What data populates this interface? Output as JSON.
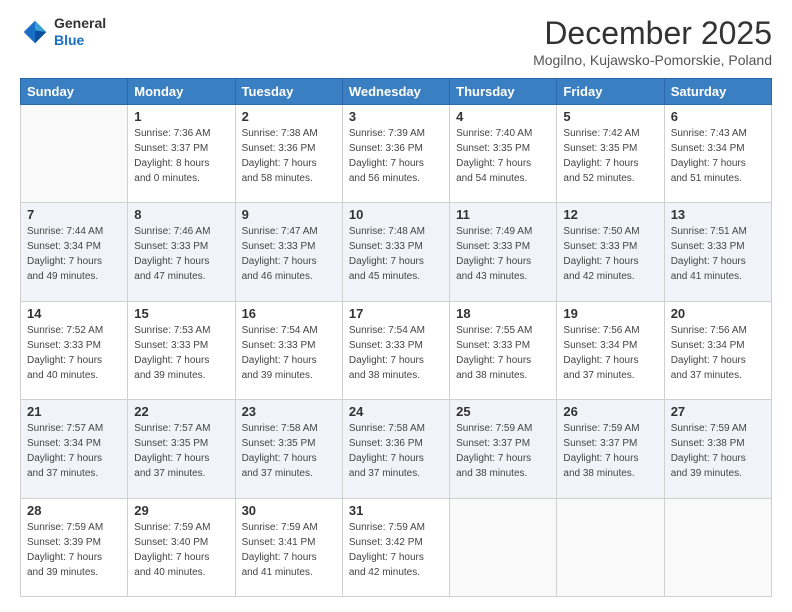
{
  "logo": {
    "general": "General",
    "blue": "Blue"
  },
  "header": {
    "month": "December 2025",
    "location": "Mogilno, Kujawsko-Pomorskie, Poland"
  },
  "weekdays": [
    "Sunday",
    "Monday",
    "Tuesday",
    "Wednesday",
    "Thursday",
    "Friday",
    "Saturday"
  ],
  "weeks": [
    [
      {
        "day": "",
        "info": ""
      },
      {
        "day": "1",
        "info": "Sunrise: 7:36 AM\nSunset: 3:37 PM\nDaylight: 8 hours\nand 0 minutes."
      },
      {
        "day": "2",
        "info": "Sunrise: 7:38 AM\nSunset: 3:36 PM\nDaylight: 7 hours\nand 58 minutes."
      },
      {
        "day": "3",
        "info": "Sunrise: 7:39 AM\nSunset: 3:36 PM\nDaylight: 7 hours\nand 56 minutes."
      },
      {
        "day": "4",
        "info": "Sunrise: 7:40 AM\nSunset: 3:35 PM\nDaylight: 7 hours\nand 54 minutes."
      },
      {
        "day": "5",
        "info": "Sunrise: 7:42 AM\nSunset: 3:35 PM\nDaylight: 7 hours\nand 52 minutes."
      },
      {
        "day": "6",
        "info": "Sunrise: 7:43 AM\nSunset: 3:34 PM\nDaylight: 7 hours\nand 51 minutes."
      }
    ],
    [
      {
        "day": "7",
        "info": "Sunrise: 7:44 AM\nSunset: 3:34 PM\nDaylight: 7 hours\nand 49 minutes."
      },
      {
        "day": "8",
        "info": "Sunrise: 7:46 AM\nSunset: 3:33 PM\nDaylight: 7 hours\nand 47 minutes."
      },
      {
        "day": "9",
        "info": "Sunrise: 7:47 AM\nSunset: 3:33 PM\nDaylight: 7 hours\nand 46 minutes."
      },
      {
        "day": "10",
        "info": "Sunrise: 7:48 AM\nSunset: 3:33 PM\nDaylight: 7 hours\nand 45 minutes."
      },
      {
        "day": "11",
        "info": "Sunrise: 7:49 AM\nSunset: 3:33 PM\nDaylight: 7 hours\nand 43 minutes."
      },
      {
        "day": "12",
        "info": "Sunrise: 7:50 AM\nSunset: 3:33 PM\nDaylight: 7 hours\nand 42 minutes."
      },
      {
        "day": "13",
        "info": "Sunrise: 7:51 AM\nSunset: 3:33 PM\nDaylight: 7 hours\nand 41 minutes."
      }
    ],
    [
      {
        "day": "14",
        "info": "Sunrise: 7:52 AM\nSunset: 3:33 PM\nDaylight: 7 hours\nand 40 minutes."
      },
      {
        "day": "15",
        "info": "Sunrise: 7:53 AM\nSunset: 3:33 PM\nDaylight: 7 hours\nand 39 minutes."
      },
      {
        "day": "16",
        "info": "Sunrise: 7:54 AM\nSunset: 3:33 PM\nDaylight: 7 hours\nand 39 minutes."
      },
      {
        "day": "17",
        "info": "Sunrise: 7:54 AM\nSunset: 3:33 PM\nDaylight: 7 hours\nand 38 minutes."
      },
      {
        "day": "18",
        "info": "Sunrise: 7:55 AM\nSunset: 3:33 PM\nDaylight: 7 hours\nand 38 minutes."
      },
      {
        "day": "19",
        "info": "Sunrise: 7:56 AM\nSunset: 3:34 PM\nDaylight: 7 hours\nand 37 minutes."
      },
      {
        "day": "20",
        "info": "Sunrise: 7:56 AM\nSunset: 3:34 PM\nDaylight: 7 hours\nand 37 minutes."
      }
    ],
    [
      {
        "day": "21",
        "info": "Sunrise: 7:57 AM\nSunset: 3:34 PM\nDaylight: 7 hours\nand 37 minutes."
      },
      {
        "day": "22",
        "info": "Sunrise: 7:57 AM\nSunset: 3:35 PM\nDaylight: 7 hours\nand 37 minutes."
      },
      {
        "day": "23",
        "info": "Sunrise: 7:58 AM\nSunset: 3:35 PM\nDaylight: 7 hours\nand 37 minutes."
      },
      {
        "day": "24",
        "info": "Sunrise: 7:58 AM\nSunset: 3:36 PM\nDaylight: 7 hours\nand 37 minutes."
      },
      {
        "day": "25",
        "info": "Sunrise: 7:59 AM\nSunset: 3:37 PM\nDaylight: 7 hours\nand 38 minutes."
      },
      {
        "day": "26",
        "info": "Sunrise: 7:59 AM\nSunset: 3:37 PM\nDaylight: 7 hours\nand 38 minutes."
      },
      {
        "day": "27",
        "info": "Sunrise: 7:59 AM\nSunset: 3:38 PM\nDaylight: 7 hours\nand 39 minutes."
      }
    ],
    [
      {
        "day": "28",
        "info": "Sunrise: 7:59 AM\nSunset: 3:39 PM\nDaylight: 7 hours\nand 39 minutes."
      },
      {
        "day": "29",
        "info": "Sunrise: 7:59 AM\nSunset: 3:40 PM\nDaylight: 7 hours\nand 40 minutes."
      },
      {
        "day": "30",
        "info": "Sunrise: 7:59 AM\nSunset: 3:41 PM\nDaylight: 7 hours\nand 41 minutes."
      },
      {
        "day": "31",
        "info": "Sunrise: 7:59 AM\nSunset: 3:42 PM\nDaylight: 7 hours\nand 42 minutes."
      },
      {
        "day": "",
        "info": ""
      },
      {
        "day": "",
        "info": ""
      },
      {
        "day": "",
        "info": ""
      }
    ]
  ]
}
